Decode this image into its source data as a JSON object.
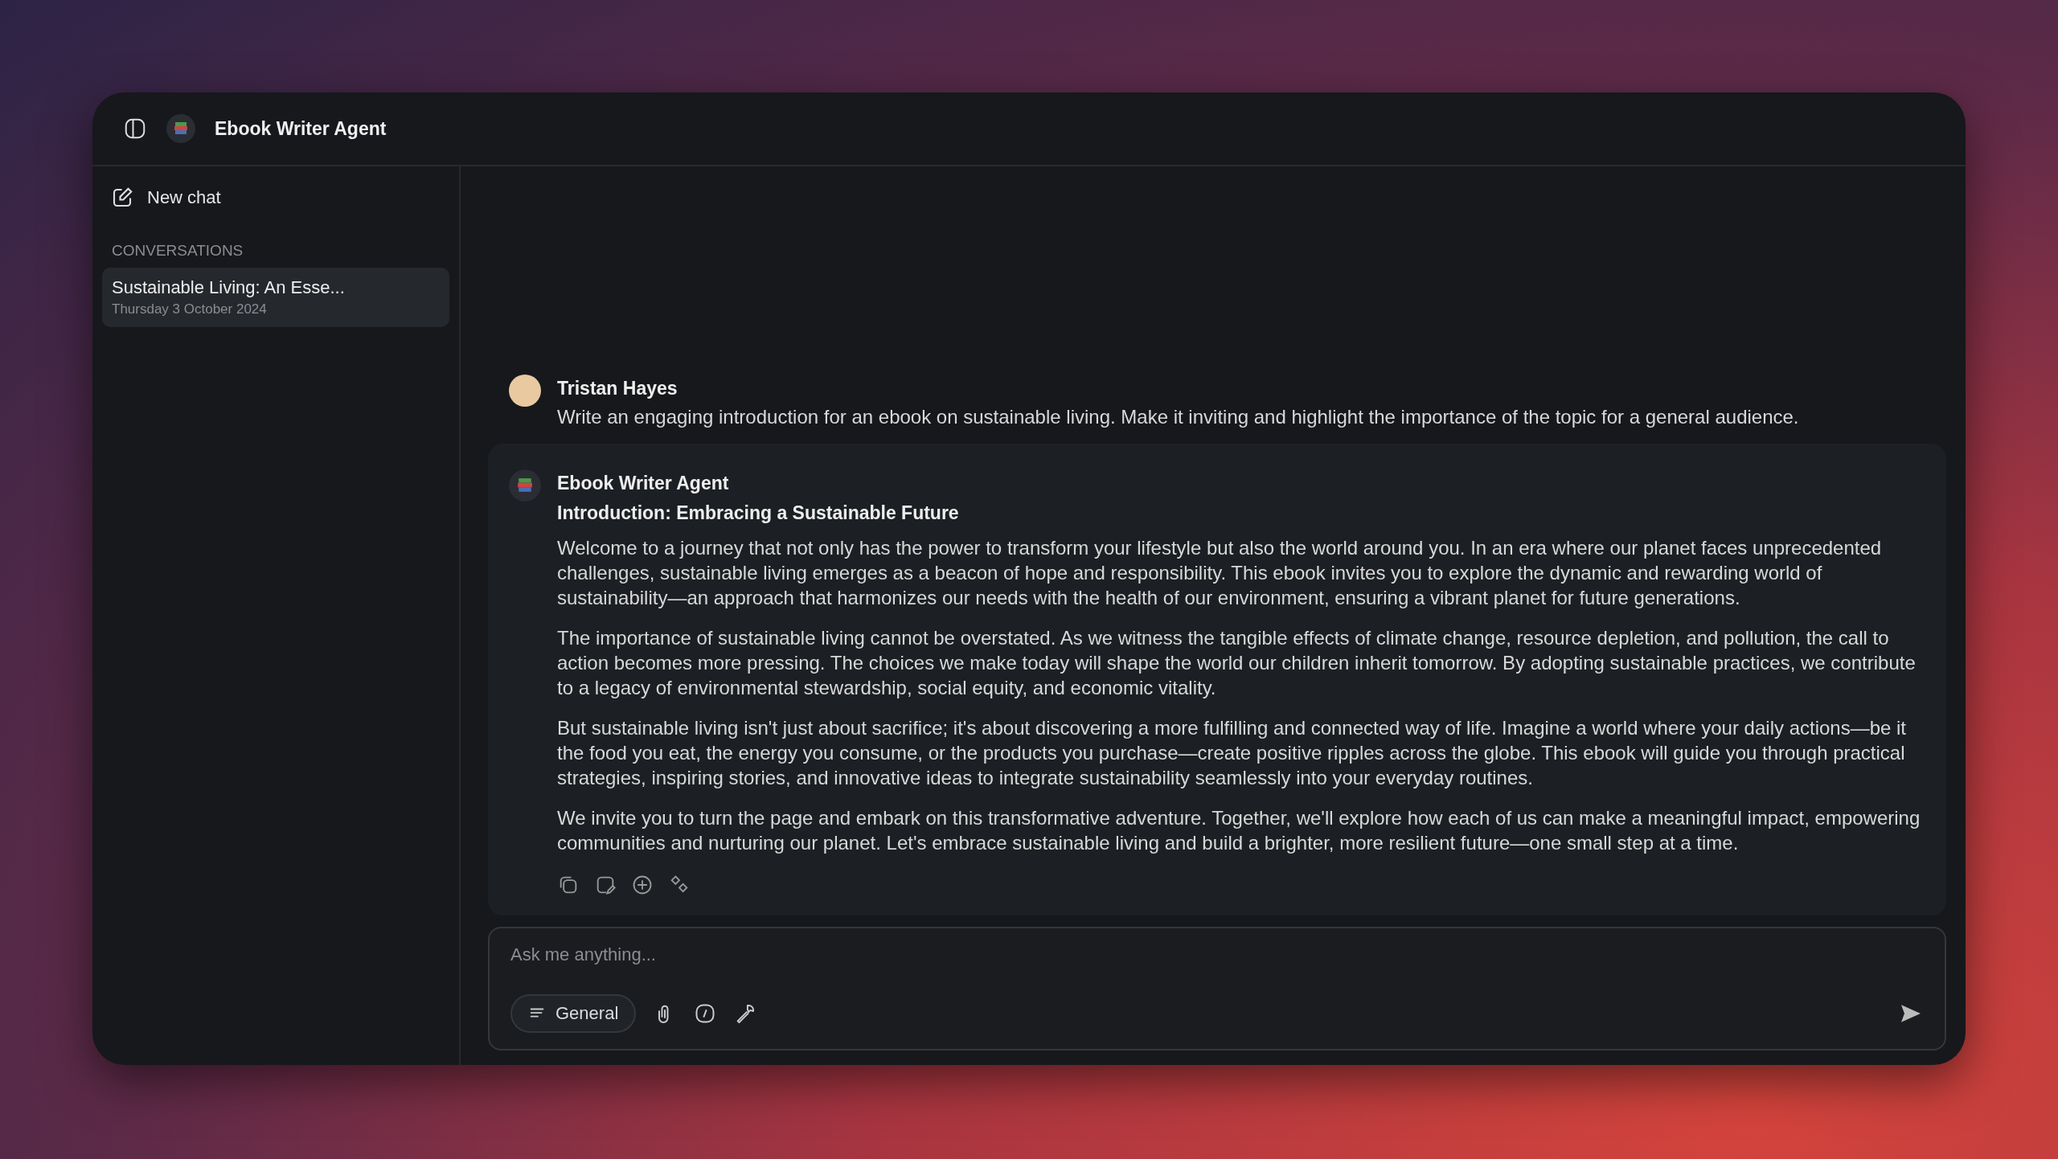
{
  "header": {
    "title": "Ebook Writer Agent"
  },
  "sidebar": {
    "new_chat": "New chat",
    "section_label": "CONVERSATIONS",
    "conversations": [
      {
        "title": "Sustainable Living: An Esse...",
        "date": "Thursday 3 October 2024",
        "selected": true
      }
    ]
  },
  "messages": [
    {
      "kind": "user",
      "author": "Tristan Hayes",
      "text": "Write an engaging introduction for an ebook on sustainable living. Make it inviting and highlight the importance of the topic for a general audience."
    },
    {
      "kind": "agent",
      "author": "Ebook Writer Agent",
      "heading": "Introduction: Embracing a Sustainable Future",
      "paragraphs": [
        "Welcome to a journey that not only has the power to transform your lifestyle but also the world around you. In an era where our planet faces unprecedented challenges, sustainable living emerges as a beacon of hope and responsibility. This ebook invites you to explore the dynamic and rewarding world of sustainability—an approach that harmonizes our needs with the health of our environment, ensuring a vibrant planet for future generations.",
        "The importance of sustainable living cannot be overstated. As we witness the tangible effects of climate change, resource depletion, and pollution, the call to action becomes more pressing. The choices we make today will shape the world our children inherit tomorrow. By adopting sustainable practices, we contribute to a legacy of environmental stewardship, social equity, and economic vitality.",
        "But sustainable living isn't just about sacrifice; it's about discovering a more fulfilling and connected way of life. Imagine a world where your daily actions—be it the food you eat, the energy you consume, or the products you purchase—create positive ripples across the globe. This ebook will guide you through practical strategies, inspiring stories, and innovative ideas to integrate sustainability seamlessly into your everyday routines.",
        "We invite you to turn the page and embark on this transformative adventure. Together, we'll explore how each of us can make a meaningful impact, empowering communities and nurturing our planet. Let's embrace sustainable living and build a brighter, more resilient future—one small step at a time."
      ]
    }
  ],
  "composer": {
    "placeholder": "Ask me anything...",
    "mode": "General"
  }
}
